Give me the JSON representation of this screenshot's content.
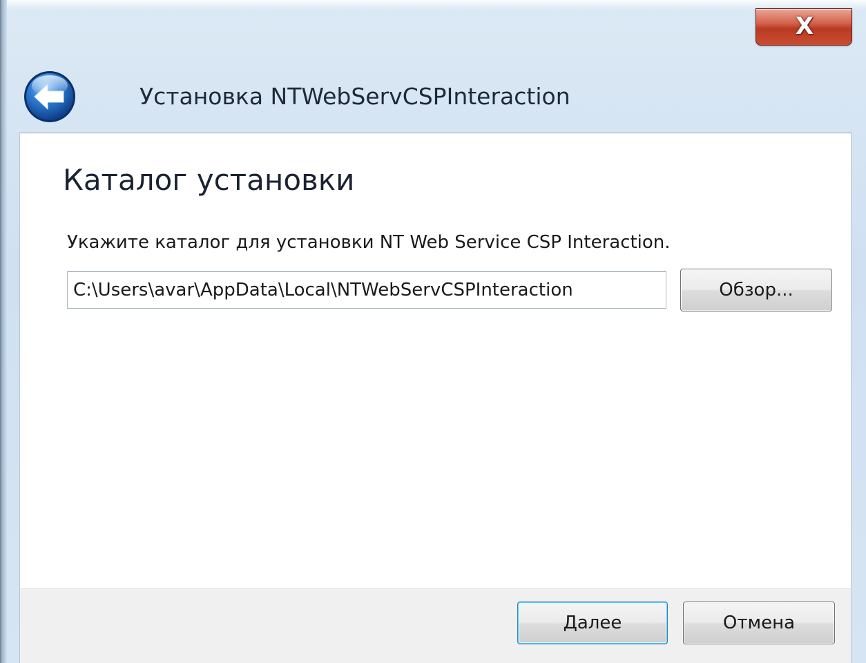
{
  "window": {
    "title": "Установка NTWebServCSPInteraction",
    "close_label": "X",
    "back_icon": "back-arrow-icon"
  },
  "page": {
    "heading": "Каталог установки",
    "instruction": "Укажите каталог для установки NT Web Service CSP Interaction.",
    "install_path": "C:\\Users\\avar\\AppData\\Local\\NTWebServCSPInteraction",
    "browse_label": "Обзор..."
  },
  "footer": {
    "next_label": "Далее",
    "cancel_label": "Отмена"
  },
  "colors": {
    "title_bar": "#cfe0f1",
    "close_button": "#c94d32",
    "back_button": "#1f63b8",
    "default_button_border": "#3c7fb1",
    "footer": "#f0f0f0"
  }
}
